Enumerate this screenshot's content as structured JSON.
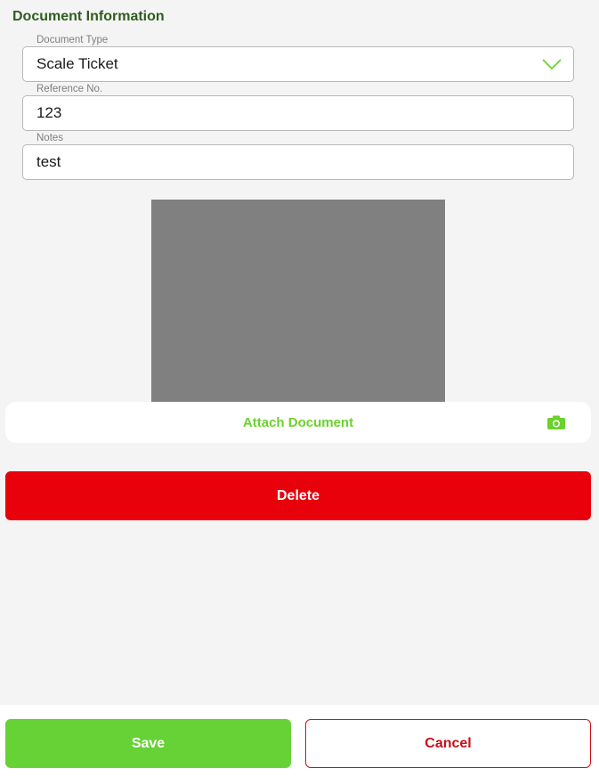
{
  "section": {
    "title": "Document Information"
  },
  "fields": {
    "document_type": {
      "label": "Document Type",
      "value": "Scale Ticket"
    },
    "reference_no": {
      "label": "Reference No.",
      "value": "123"
    },
    "notes": {
      "label": "Notes",
      "value": "test"
    }
  },
  "preview": {
    "icon": "image-placeholder"
  },
  "attach": {
    "label": "Attach Document",
    "icon": "camera-icon"
  },
  "actions": {
    "delete_label": "Delete",
    "save_label": "Save",
    "cancel_label": "Cancel"
  },
  "colors": {
    "accent_green": "#6cd12f",
    "title_green": "#2f5d1e",
    "delete_red": "#e8000b",
    "cancel_red": "#c8101a"
  }
}
